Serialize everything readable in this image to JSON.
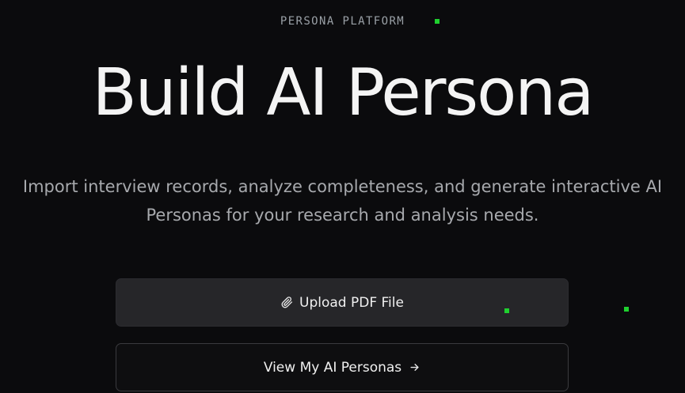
{
  "hero": {
    "eyebrow": "PERSONA PLATFORM",
    "title": "Build AI Persona",
    "subtitle": "Import interview records, analyze completeness, and generate interactive AI Personas for your research and analysis needs."
  },
  "actions": {
    "upload_label": "Upload PDF File",
    "view_label": "View My AI Personas"
  },
  "icons": {
    "upload": "paperclip-icon",
    "view": "arrow-right-icon"
  },
  "colors": {
    "background": "#0b0b0d",
    "accent_marker": "#1fd12f",
    "primary_button": "#262629"
  }
}
